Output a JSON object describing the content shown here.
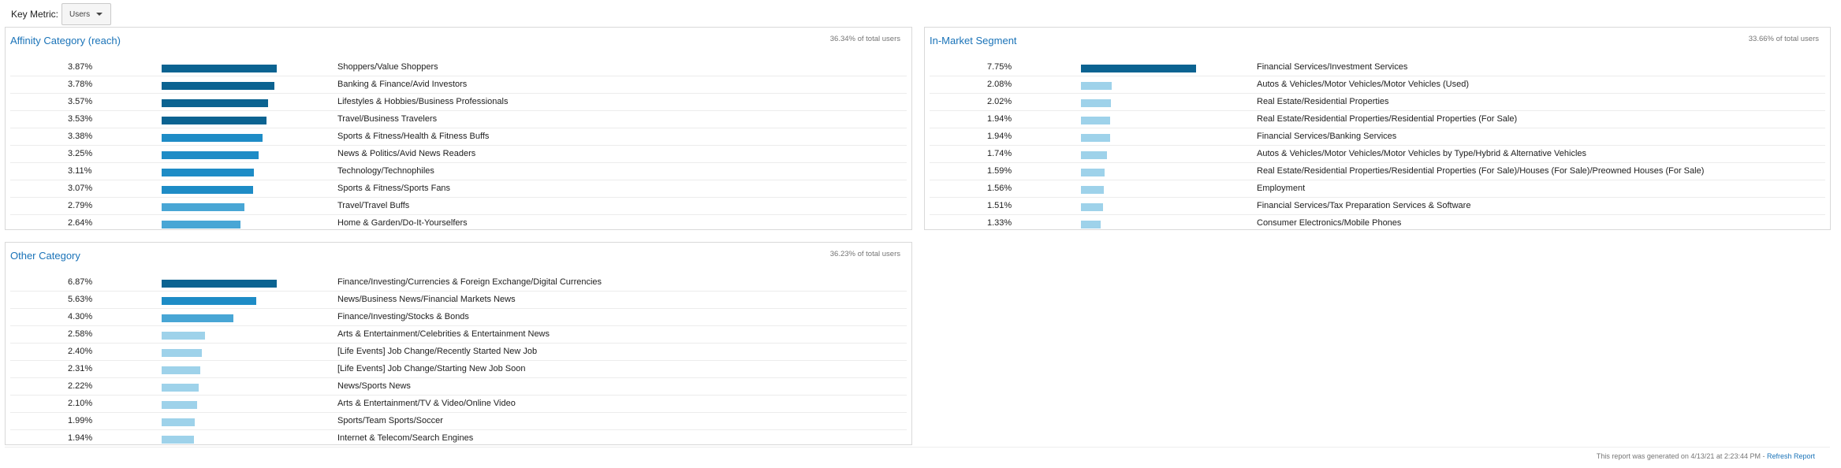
{
  "key_metric": {
    "label": "Key Metric:",
    "value": "Users"
  },
  "colors": {
    "dark": "#0b6391",
    "medium": "#1e8cc6",
    "light": "#48a6d5",
    "pale": "#9ed2ea"
  },
  "cards": [
    {
      "title": "Affinity Category (reach)",
      "total": "36.34% of total users",
      "rows": [
        {
          "pct": "3.87%",
          "value": 3.87,
          "name": "Shoppers/Value Shoppers",
          "tone": "dark"
        },
        {
          "pct": "3.78%",
          "value": 3.78,
          "name": "Banking & Finance/Avid Investors",
          "tone": "dark"
        },
        {
          "pct": "3.57%",
          "value": 3.57,
          "name": "Lifestyles & Hobbies/Business Professionals",
          "tone": "dark"
        },
        {
          "pct": "3.53%",
          "value": 3.53,
          "name": "Travel/Business Travelers",
          "tone": "dark"
        },
        {
          "pct": "3.38%",
          "value": 3.38,
          "name": "Sports & Fitness/Health & Fitness Buffs",
          "tone": "medium"
        },
        {
          "pct": "3.25%",
          "value": 3.25,
          "name": "News & Politics/Avid News Readers",
          "tone": "medium"
        },
        {
          "pct": "3.11%",
          "value": 3.11,
          "name": "Technology/Technophiles",
          "tone": "medium"
        },
        {
          "pct": "3.07%",
          "value": 3.07,
          "name": "Sports & Fitness/Sports Fans",
          "tone": "medium"
        },
        {
          "pct": "2.79%",
          "value": 2.79,
          "name": "Travel/Travel Buffs",
          "tone": "light"
        },
        {
          "pct": "2.64%",
          "value": 2.64,
          "name": "Home & Garden/Do-It-Yourselfers",
          "tone": "light"
        }
      ]
    },
    {
      "title": "In-Market Segment",
      "total": "33.66% of total users",
      "rows": [
        {
          "pct": "7.75%",
          "value": 7.75,
          "name": "Financial Services/Investment Services",
          "tone": "dark"
        },
        {
          "pct": "2.08%",
          "value": 2.08,
          "name": "Autos & Vehicles/Motor Vehicles/Motor Vehicles (Used)",
          "tone": "pale"
        },
        {
          "pct": "2.02%",
          "value": 2.02,
          "name": "Real Estate/Residential Properties",
          "tone": "pale"
        },
        {
          "pct": "1.94%",
          "value": 1.94,
          "name": "Real Estate/Residential Properties/Residential Properties (For Sale)",
          "tone": "pale"
        },
        {
          "pct": "1.94%",
          "value": 1.94,
          "name": "Financial Services/Banking Services",
          "tone": "pale"
        },
        {
          "pct": "1.74%",
          "value": 1.74,
          "name": "Autos & Vehicles/Motor Vehicles/Motor Vehicles by Type/Hybrid & Alternative Vehicles",
          "tone": "pale"
        },
        {
          "pct": "1.59%",
          "value": 1.59,
          "name": "Real Estate/Residential Properties/Residential Properties (For Sale)/Houses (For Sale)/Preowned Houses (For Sale)",
          "tone": "pale"
        },
        {
          "pct": "1.56%",
          "value": 1.56,
          "name": "Employment",
          "tone": "pale"
        },
        {
          "pct": "1.51%",
          "value": 1.51,
          "name": "Financial Services/Tax Preparation Services & Software",
          "tone": "pale"
        },
        {
          "pct": "1.33%",
          "value": 1.33,
          "name": "Consumer Electronics/Mobile Phones",
          "tone": "pale"
        }
      ]
    },
    {
      "title": "Other Category",
      "total": "36.23% of total users",
      "rows": [
        {
          "pct": "6.87%",
          "value": 6.87,
          "name": "Finance/Investing/Currencies & Foreign Exchange/Digital Currencies",
          "tone": "dark"
        },
        {
          "pct": "5.63%",
          "value": 5.63,
          "name": "News/Business News/Financial Markets News",
          "tone": "medium"
        },
        {
          "pct": "4.30%",
          "value": 4.3,
          "name": "Finance/Investing/Stocks & Bonds",
          "tone": "light"
        },
        {
          "pct": "2.58%",
          "value": 2.58,
          "name": "Arts & Entertainment/Celebrities & Entertainment News",
          "tone": "pale"
        },
        {
          "pct": "2.40%",
          "value": 2.4,
          "name": "[Life Events] Job Change/Recently Started New Job",
          "tone": "pale"
        },
        {
          "pct": "2.31%",
          "value": 2.31,
          "name": "[Life Events] Job Change/Starting New Job Soon",
          "tone": "pale"
        },
        {
          "pct": "2.22%",
          "value": 2.22,
          "name": "News/Sports News",
          "tone": "pale"
        },
        {
          "pct": "2.10%",
          "value": 2.1,
          "name": "Arts & Entertainment/TV & Video/Online Video",
          "tone": "pale"
        },
        {
          "pct": "1.99%",
          "value": 1.99,
          "name": "Sports/Team Sports/Soccer",
          "tone": "pale"
        },
        {
          "pct": "1.94%",
          "value": 1.94,
          "name": "Internet & Telecom/Search Engines",
          "tone": "pale"
        }
      ]
    }
  ],
  "footer": {
    "generated": "This report was generated on 4/13/21 at 2:23:44 PM - ",
    "refresh": "Refresh Report"
  }
}
